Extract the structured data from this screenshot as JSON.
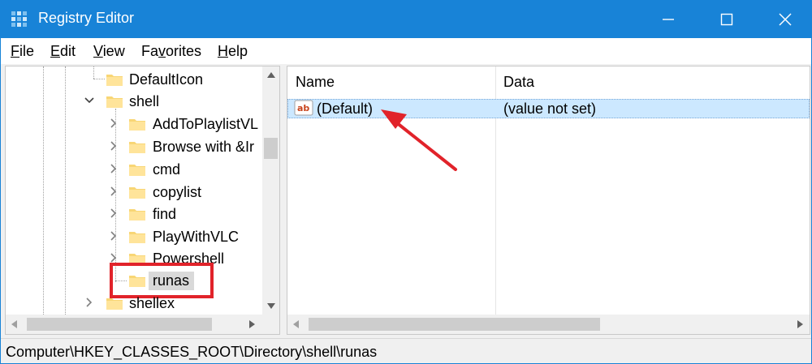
{
  "window": {
    "title": "Registry Editor",
    "accent_color": "#1883d7",
    "icons": {
      "app": "registry-editor-icon",
      "minimize": "minimize-icon",
      "maximize": "maximize-icon",
      "close": "close-icon"
    }
  },
  "menu": {
    "items": [
      {
        "accel": "F",
        "rest": "ile"
      },
      {
        "accel": "E",
        "rest": "dit"
      },
      {
        "accel": "V",
        "rest": "iew"
      },
      {
        "accel": "",
        "pre": "F",
        "rest_pre": "",
        "label_a": "Fa",
        "label_u": "v",
        "label_b": "orites"
      },
      {
        "accel": "H",
        "rest": "elp"
      }
    ]
  },
  "tree": {
    "nodes": [
      {
        "label": "DefaultIcon",
        "expander": "none"
      },
      {
        "label": "shell",
        "expander": "expanded"
      },
      {
        "label": "AddToPlaylistVL",
        "expander": "collapsed"
      },
      {
        "label": "Browse with &Ir",
        "expander": "collapsed"
      },
      {
        "label": "cmd",
        "expander": "collapsed"
      },
      {
        "label": "copylist",
        "expander": "collapsed"
      },
      {
        "label": "find",
        "expander": "collapsed"
      },
      {
        "label": "PlayWithVLC",
        "expander": "collapsed"
      },
      {
        "label": "Powershell",
        "expander": "collapsed"
      },
      {
        "label": "runas",
        "expander": "none",
        "selected": true
      },
      {
        "label": "shellex",
        "expander": "collapsed"
      }
    ],
    "highlight_color": "#e1232a"
  },
  "list": {
    "columns": [
      "Name",
      "Data"
    ],
    "rows": [
      {
        "name": "(Default)",
        "data": "(value not set)",
        "icon": "string-value-icon",
        "icon_text": "ab"
      }
    ],
    "selected_color": "#cce8ff"
  },
  "status": {
    "path": "Computer\\HKEY_CLASSES_ROOT\\Directory\\shell\\runas"
  },
  "annotation": {
    "arrow_color": "#e1232a"
  }
}
